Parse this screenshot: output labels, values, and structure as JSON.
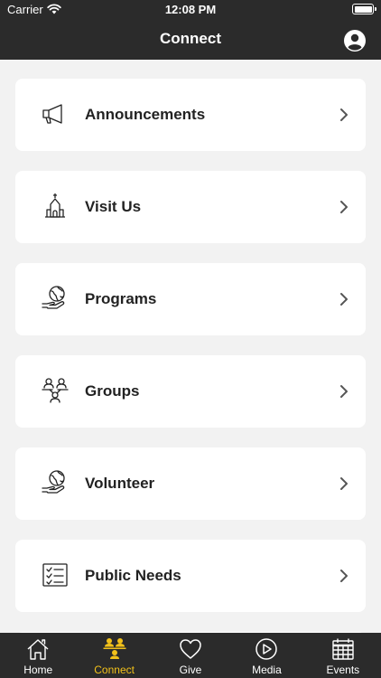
{
  "status_bar": {
    "carrier": "Carrier",
    "time": "12:08 PM"
  },
  "header": {
    "title": "Connect",
    "profile_icon": "person-circle-icon"
  },
  "items": [
    {
      "label": "Announcements",
      "icon": "megaphone-icon"
    },
    {
      "label": "Visit Us",
      "icon": "church-icon"
    },
    {
      "label": "Programs",
      "icon": "globe-in-hand-icon"
    },
    {
      "label": "Groups",
      "icon": "group-people-icon"
    },
    {
      "label": "Volunteer",
      "icon": "globe-in-hand-icon"
    },
    {
      "label": "Public Needs",
      "icon": "checklist-icon"
    }
  ],
  "tabs": [
    {
      "label": "Home",
      "icon": "home-icon",
      "active": false
    },
    {
      "label": "Connect",
      "icon": "people-icon",
      "active": true
    },
    {
      "label": "Give",
      "icon": "heart-icon",
      "active": false
    },
    {
      "label": "Media",
      "icon": "play-circle-icon",
      "active": false
    },
    {
      "label": "Events",
      "icon": "calendar-icon",
      "active": false
    }
  ],
  "colors": {
    "bar": "#2b2b2b",
    "background": "#f2f2f2",
    "accent": "#f2c11a",
    "card": "#ffffff"
  }
}
